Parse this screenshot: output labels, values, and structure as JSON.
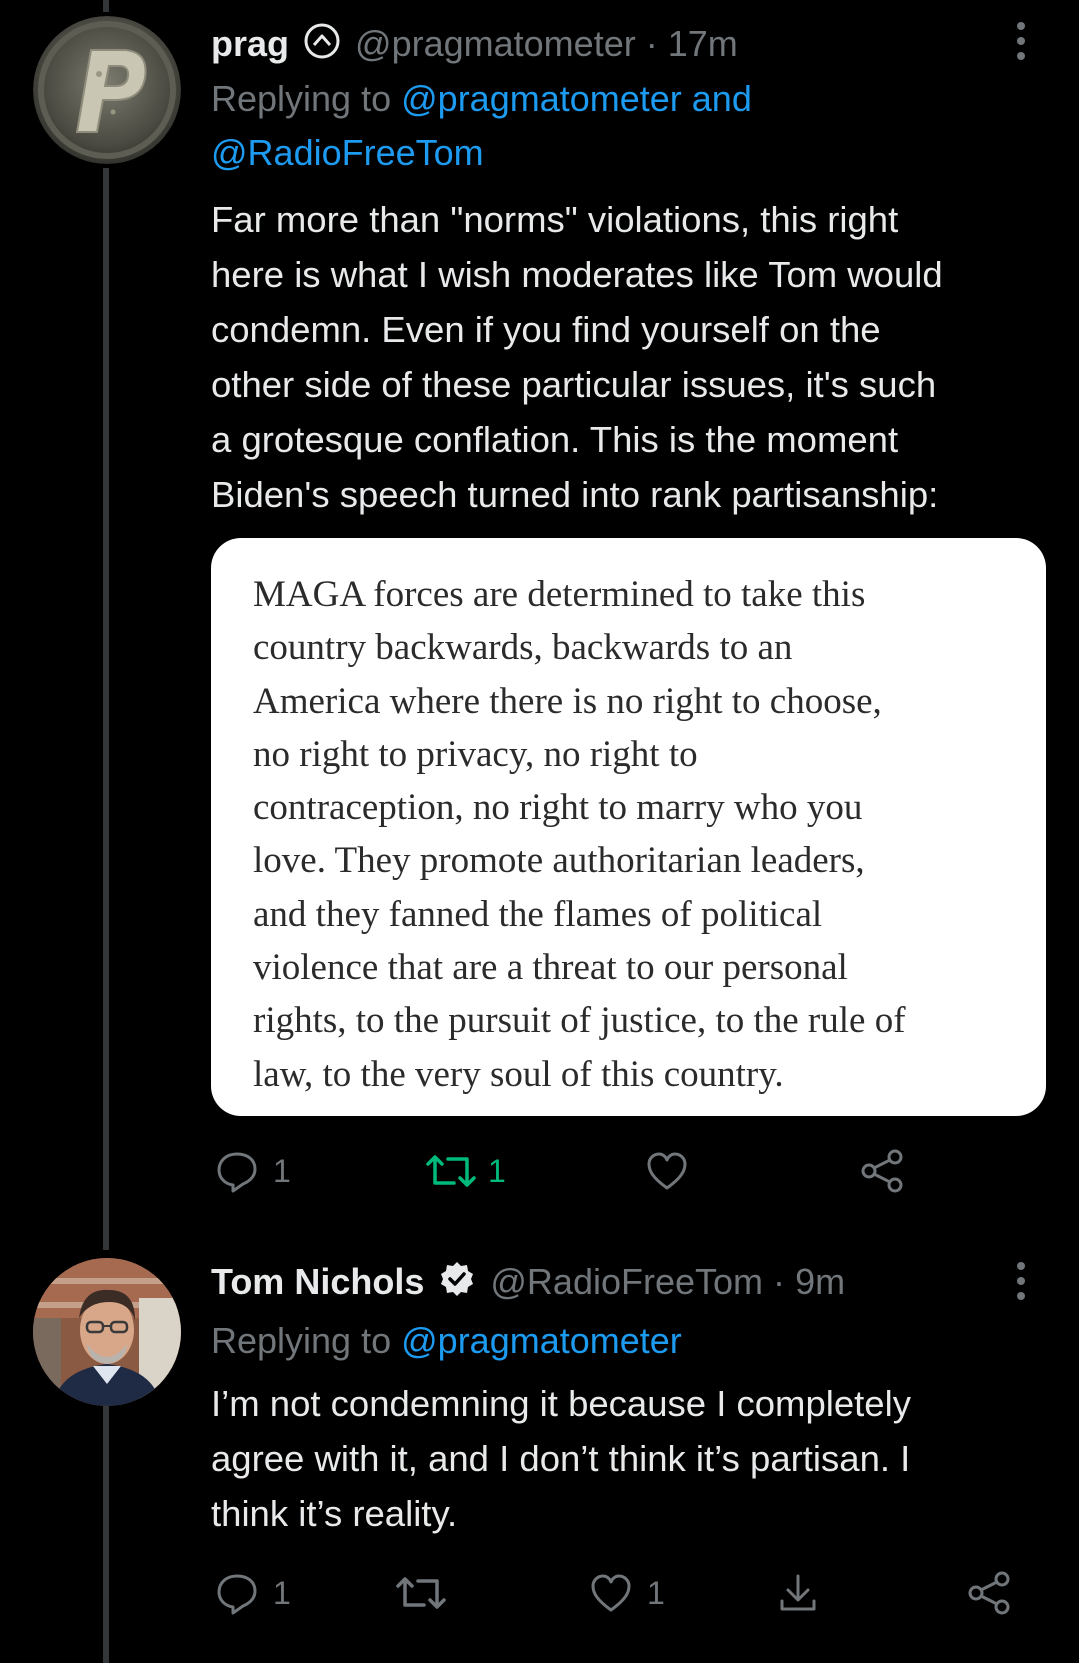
{
  "colors": {
    "background": "#000000",
    "text": "#e7e9ea",
    "muted": "#71767b",
    "link": "#1d9bf0",
    "retweeted": "#00ba7c",
    "thread_line": "#333639"
  },
  "tweets": [
    {
      "display_name": "prag",
      "badge_icon": "circle-chevron-up-icon",
      "handle": "@pragmatometer",
      "separator": "·",
      "time": "17m",
      "replying_prefix": "Replying to",
      "replying_line1": "@pragmatometer and",
      "replying_line2": "@RadioFreeTom",
      "body_lines": [
        "Far more than \"norms\" violations, this right",
        "here is what I wish moderates like Tom would",
        "condemn. Even if you find yourself on the",
        "other side of these particular issues, it's such",
        "a grotesque conflation. This is the moment",
        "Biden's speech turned into rank partisanship:"
      ],
      "quote_image_lines": [
        "MAGA forces are determined to take this",
        "country backwards, backwards to an",
        "America where there is no right to choose,",
        "no right to privacy, no right to",
        "contraception, no right to marry who you",
        "love. They promote authoritarian leaders,",
        "and they fanned the flames of political",
        "violence that are a threat to our personal",
        "rights, to the pursuit of justice, to the rule of",
        "law, to the very soul of this country."
      ],
      "actions": {
        "reply_count": "1",
        "retweet_count": "1",
        "like_count": ""
      }
    },
    {
      "display_name": "Tom Nichols",
      "badge_icon": "verified-badge-icon",
      "handle": "@RadioFreeTom",
      "separator": "·",
      "time": "9m",
      "replying_prefix": "Replying to",
      "replying_line1": "@pragmatometer",
      "body_lines": [
        "I’m not condemning it because I completely",
        "agree with it, and I don’t think it’s partisan. I",
        "think it’s reality."
      ],
      "actions": {
        "reply_count": "1",
        "retweet_count": "",
        "like_count": "1"
      }
    }
  ]
}
